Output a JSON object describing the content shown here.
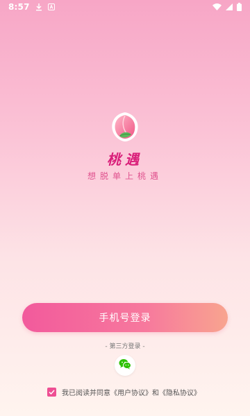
{
  "status_bar": {
    "time": "8:57",
    "icons": [
      "download-icon",
      "notification-a-icon",
      "wifi-icon",
      "signal-icon",
      "battery-icon"
    ]
  },
  "app": {
    "title": "桃遇",
    "slogan": "想脱单上桃遇"
  },
  "login": {
    "phone_button": "手机号登录",
    "third_party_label": "- 第三方登录 -",
    "wechat_icon": "wechat-icon"
  },
  "agreement": {
    "checked": true,
    "prefix": "我已阅读并同意",
    "user_agreement": "《用户协议》",
    "conjunction": "和",
    "privacy_agreement": "《隐私协议》"
  },
  "colors": {
    "brand": "#d9207a",
    "button_start": "#f25a9c",
    "button_end": "#f8a48f",
    "checkbox": "#ee4f93",
    "wechat": "#2dc100"
  }
}
